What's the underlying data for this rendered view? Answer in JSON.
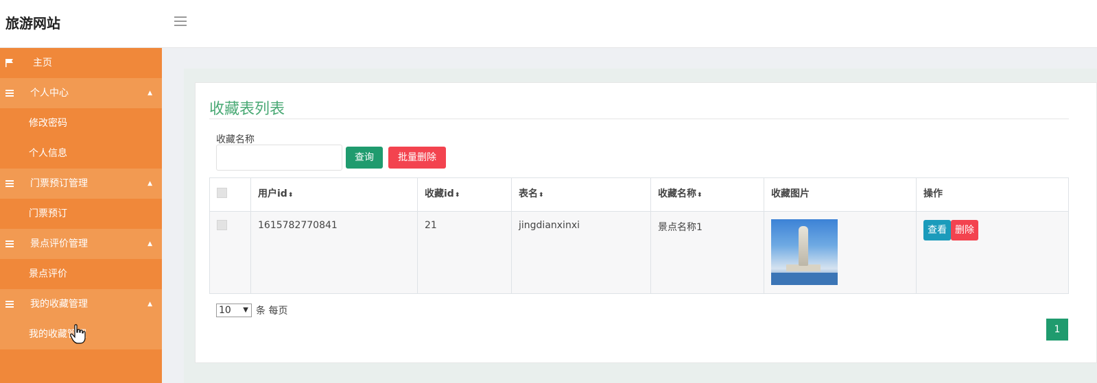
{
  "header": {
    "brand": "旅游网站"
  },
  "sidebar": {
    "items": [
      {
        "label": "主页",
        "type": "item",
        "icon": "flag-icon"
      },
      {
        "label": "个人中心",
        "type": "header",
        "icon": "list-icon",
        "caret": "▲"
      },
      {
        "label": "修改密码",
        "type": "sub"
      },
      {
        "label": "个人信息",
        "type": "sub"
      },
      {
        "label": "门票预订管理",
        "type": "header",
        "icon": "list-icon",
        "caret": "▲"
      },
      {
        "label": "门票预订",
        "type": "sub"
      },
      {
        "label": "景点评价管理",
        "type": "header",
        "icon": "list-icon",
        "caret": "▲"
      },
      {
        "label": "景点评价",
        "type": "sub"
      },
      {
        "label": "我的收藏管理",
        "type": "header",
        "icon": "list-icon",
        "caret": "▲"
      },
      {
        "label": "我的收藏管理",
        "type": "sub",
        "active": true
      }
    ]
  },
  "main": {
    "title": "收藏表列表",
    "search": {
      "label": "收藏名称",
      "value": "",
      "placeholder": ""
    },
    "buttons": {
      "query": "查询",
      "batch_delete": "批量删除"
    },
    "table": {
      "headers": [
        "用户id",
        "收藏id",
        "表名",
        "收藏名称",
        "收藏图片",
        "操作"
      ],
      "sortable": [
        true,
        true,
        true,
        true,
        false,
        false
      ],
      "sort_icon": "⬍",
      "rows": [
        {
          "user_id": "1615782770841",
          "fav_id": "21",
          "table_name": "jingdianxinxi",
          "fav_name": "景点名称1",
          "image": "statue-thumbnail",
          "actions": {
            "view": "查看",
            "delete": "删除"
          }
        }
      ]
    },
    "pager": {
      "page_size": "10",
      "page_size_suffix": "条 每页",
      "current_page": "1"
    }
  },
  "colors": {
    "sidebar_bg": "#f0883a",
    "sidebar_header_bg": "#f29a52",
    "title_green": "#49a974",
    "btn_query": "#1f9b6e",
    "btn_delete": "#f3434f",
    "btn_view": "#1b9bbb"
  }
}
